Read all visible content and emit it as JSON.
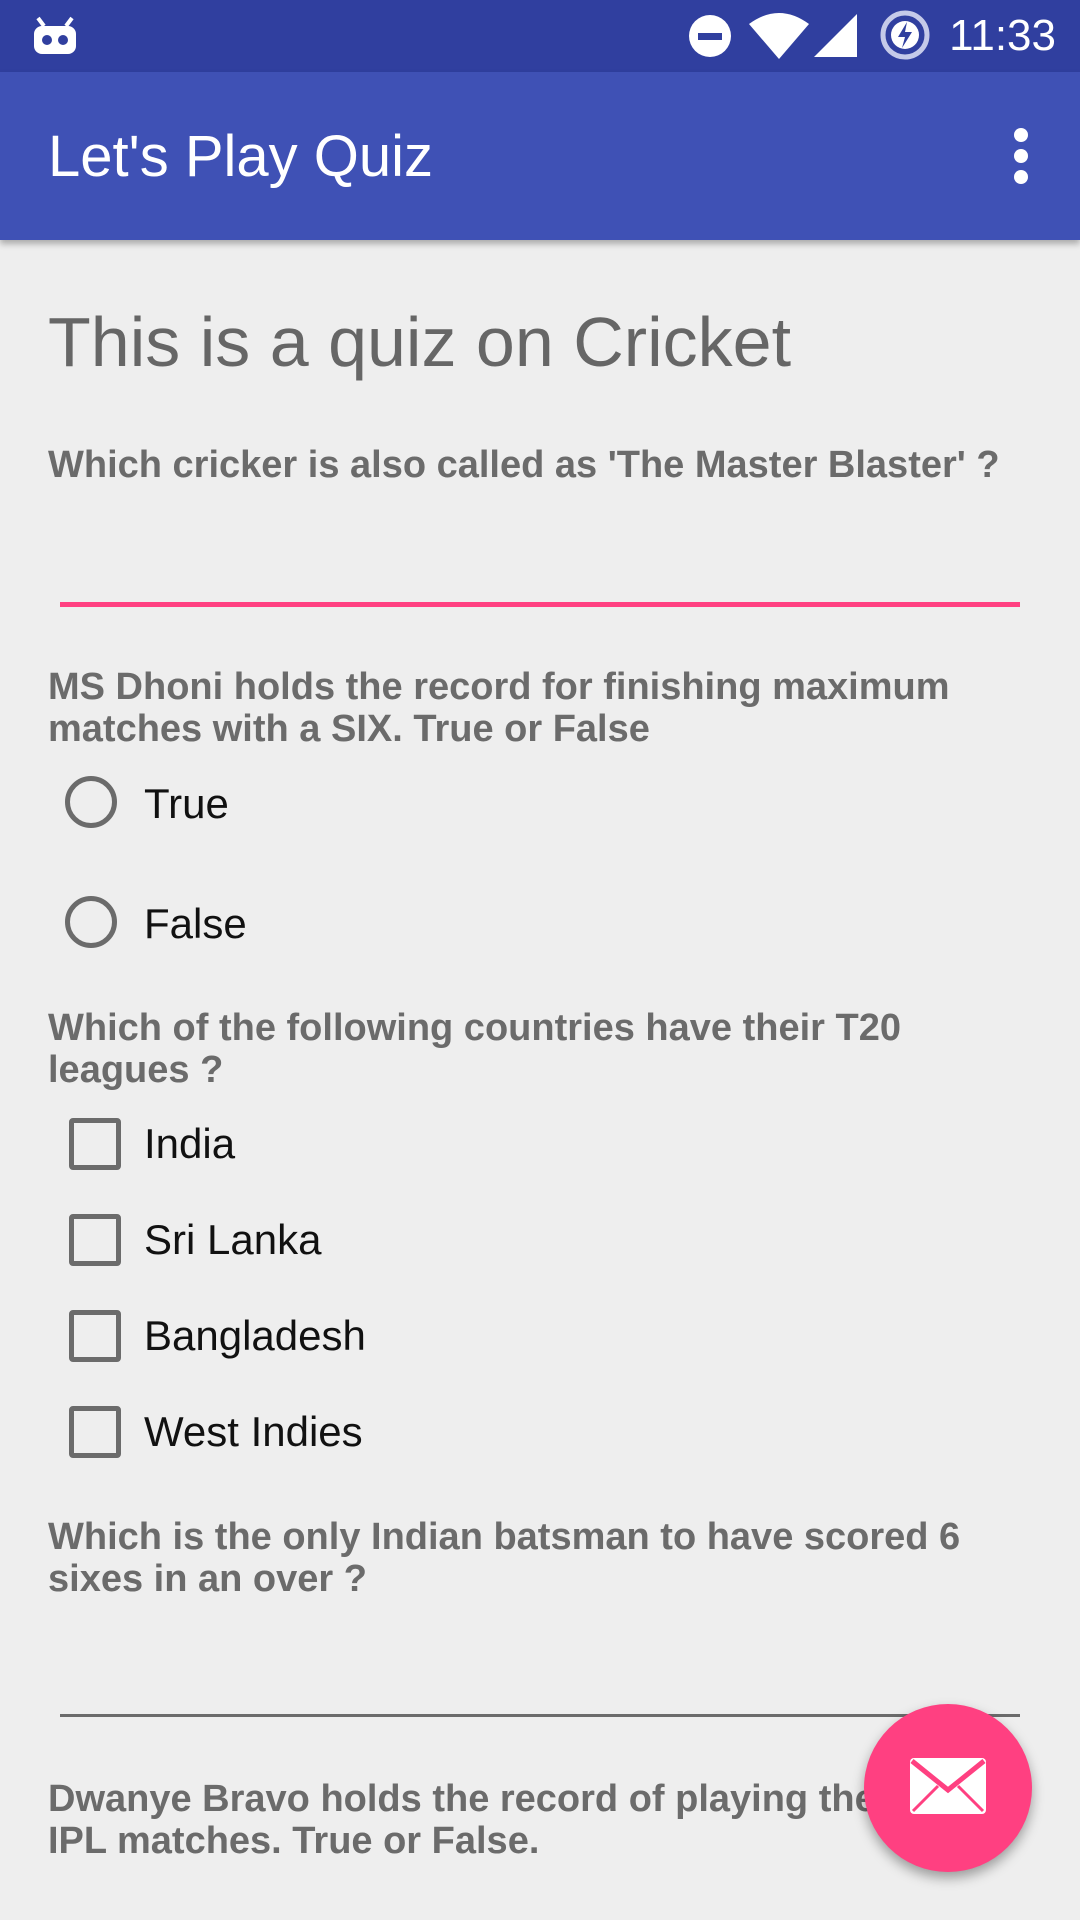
{
  "status_bar": {
    "time": "11:33",
    "icons": [
      "android-debug-icon",
      "do-not-disturb-icon",
      "wifi-icon",
      "signal-icon",
      "battery-charging-icon"
    ]
  },
  "app_bar": {
    "title": "Let's Play Quiz",
    "menu_icon": "more-vert-icon"
  },
  "quiz": {
    "heading": "This is a quiz on Cricket",
    "q1": {
      "text": "Which cricker is also called as 'The Master Blaster' ?",
      "answer_value": "",
      "accent": "#FF4081"
    },
    "q2": {
      "text": "MS Dhoni holds the record for finishing maximum matches with a SIX. True or False",
      "options": [
        "True",
        "False"
      ]
    },
    "q3": {
      "text": "Which of the following countries have their T20 leagues ?",
      "options": [
        "India",
        "Sri Lanka",
        "Bangladesh",
        "West Indies"
      ]
    },
    "q4": {
      "text": "Which is the only Indian batsman to have scored 6 sixes in an over ?",
      "answer_value": ""
    },
    "q5": {
      "text": "Dwanye Bravo holds the record of playing the most IPL matches. True or False."
    }
  },
  "fab": {
    "icon": "email-icon",
    "color": "#FF4081"
  },
  "colors": {
    "primary": "#3F51B5",
    "primary_dark": "#303F9F",
    "accent": "#FF4081",
    "background": "#EEEEEE"
  }
}
